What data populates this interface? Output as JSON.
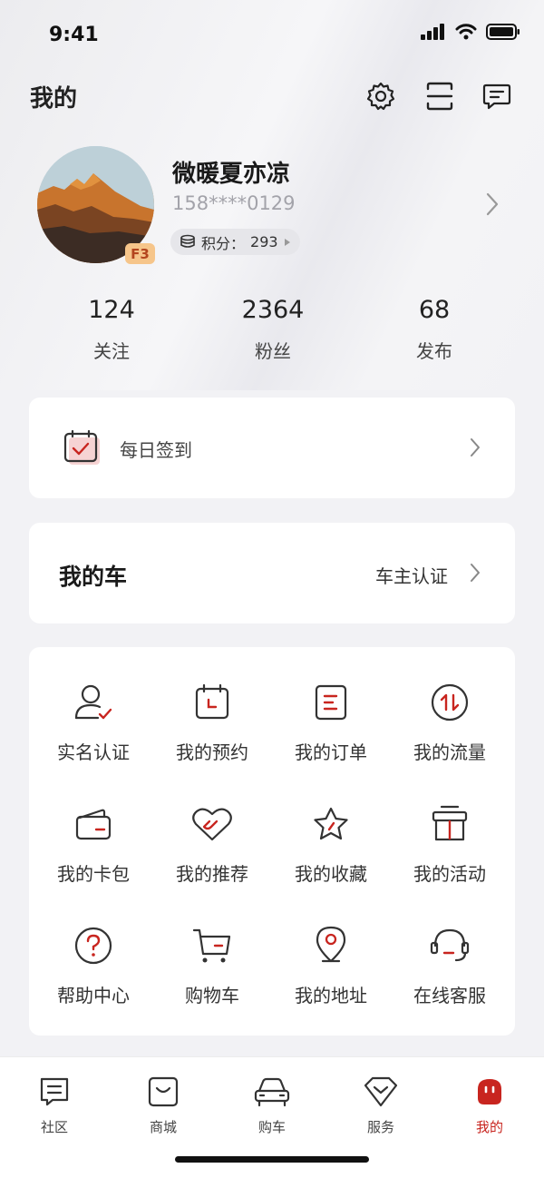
{
  "status_bar": {
    "time": "9:41"
  },
  "header": {
    "title": "我的"
  },
  "profile": {
    "username": "微暖夏亦凉",
    "phone": "158****0129",
    "level": "F3",
    "points_label": "积分：",
    "points_value": "293"
  },
  "stats": [
    {
      "value": "124",
      "label": "关注"
    },
    {
      "value": "2364",
      "label": "粉丝"
    },
    {
      "value": "68",
      "label": "发布"
    }
  ],
  "checkin": {
    "label": "每日签到"
  },
  "my_car": {
    "title": "我的车",
    "certify_label": "车主认证"
  },
  "grid": [
    {
      "label": "实名认证",
      "icon": "user-verify-icon"
    },
    {
      "label": "我的预约",
      "icon": "calendar-icon"
    },
    {
      "label": "我的订单",
      "icon": "order-icon"
    },
    {
      "label": "我的流量",
      "icon": "data-flow-icon"
    },
    {
      "label": "我的卡包",
      "icon": "wallet-icon"
    },
    {
      "label": "我的推荐",
      "icon": "recommend-icon"
    },
    {
      "label": "我的收藏",
      "icon": "star-icon"
    },
    {
      "label": "我的活动",
      "icon": "gift-icon"
    },
    {
      "label": "帮助中心",
      "icon": "help-icon"
    },
    {
      "label": "购物车",
      "icon": "cart-icon"
    },
    {
      "label": "我的地址",
      "icon": "location-icon"
    },
    {
      "label": "在线客服",
      "icon": "headset-icon"
    }
  ],
  "bottom_nav": [
    {
      "label": "社区",
      "icon": "community-icon"
    },
    {
      "label": "商城",
      "icon": "mall-icon"
    },
    {
      "label": "购车",
      "icon": "car-icon"
    },
    {
      "label": "服务",
      "icon": "service-icon"
    },
    {
      "label": "我的",
      "icon": "profile-icon",
      "active": true
    }
  ],
  "colors": {
    "accent": "#c8251f",
    "background": "#f2f2f5",
    "card": "#ffffff"
  }
}
